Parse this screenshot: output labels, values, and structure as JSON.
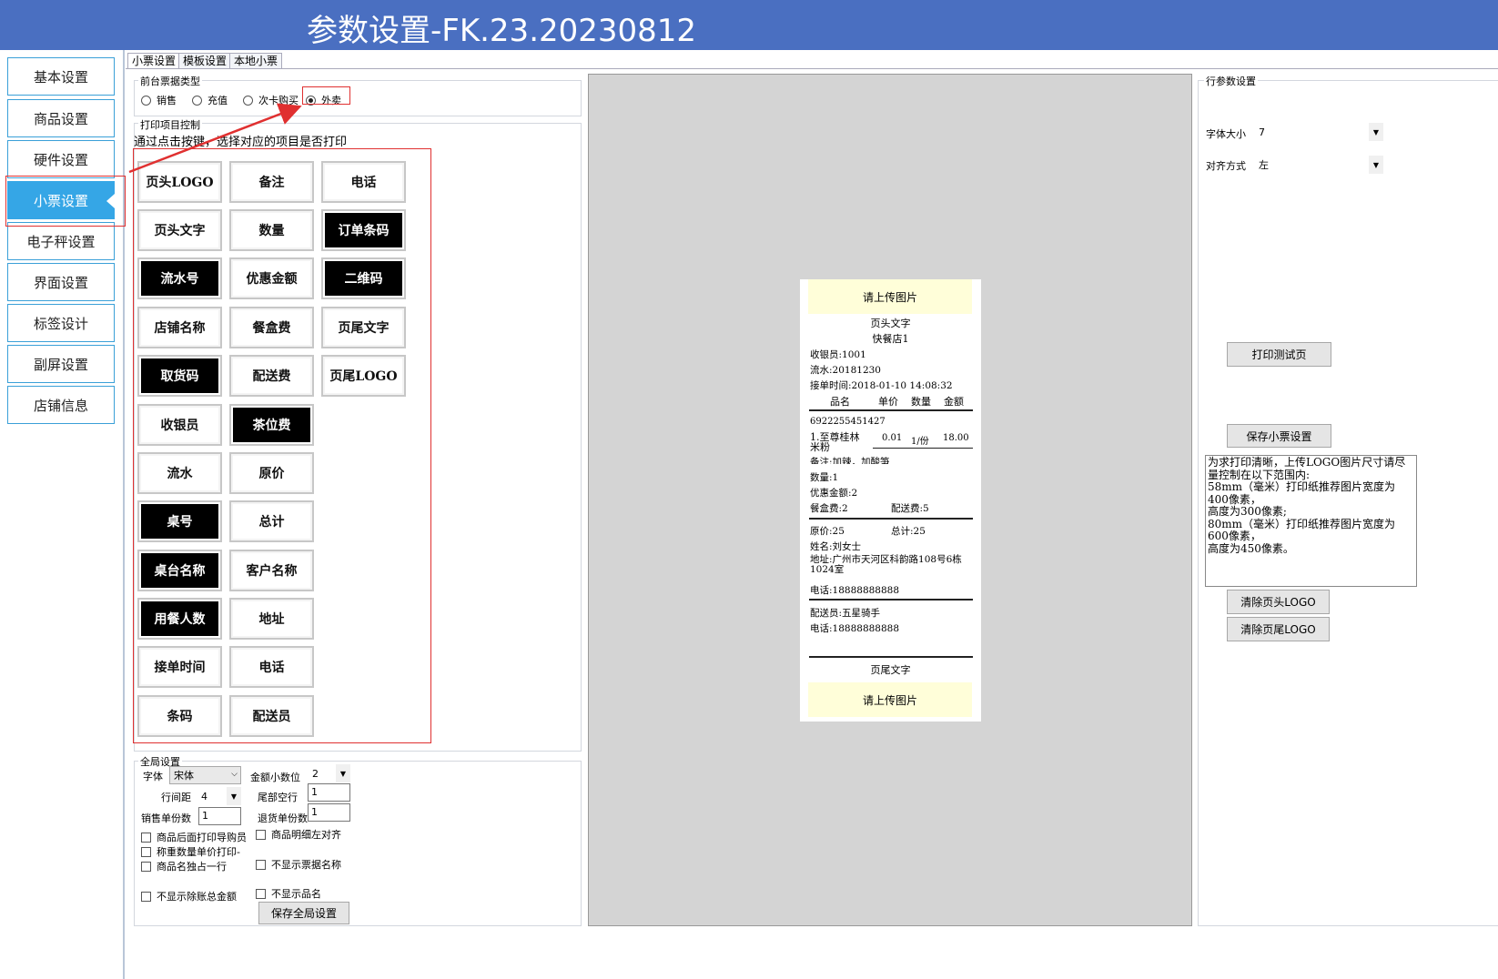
{
  "window": {
    "title": "参数设置-FK.23.20230812"
  },
  "sidebar": {
    "items": [
      {
        "label": "基本设置"
      },
      {
        "label": "商品设置"
      },
      {
        "label": "硬件设置"
      },
      {
        "label": "小票设置"
      },
      {
        "label": "电子秤设置"
      },
      {
        "label": "界面设置"
      },
      {
        "label": "标签设计"
      },
      {
        "label": "副屏设置"
      },
      {
        "label": "店铺信息"
      }
    ],
    "active_index": 3
  },
  "tabs": [
    {
      "label": "小票设置"
    },
    {
      "label": "模板设置"
    },
    {
      "label": "本地小票"
    }
  ],
  "ticket_type": {
    "group_label": "前台票据类型",
    "options": [
      {
        "label": "销售"
      },
      {
        "label": "充值"
      },
      {
        "label": "次卡购买"
      },
      {
        "label": "外卖"
      }
    ],
    "selected_index": 3
  },
  "print_items": {
    "group_label": "打印项目控制",
    "instruction": "通过点击按键，选择对应的项目是否打印",
    "buttons": [
      {
        "label": "页头LOGO",
        "on": false
      },
      {
        "label": "备注",
        "on": false
      },
      {
        "label": "电话",
        "on": false
      },
      {
        "label": "页头文字",
        "on": false
      },
      {
        "label": "数量",
        "on": false
      },
      {
        "label": "订单条码",
        "on": true
      },
      {
        "label": "流水号",
        "on": true
      },
      {
        "label": "优惠金额",
        "on": false
      },
      {
        "label": "二维码",
        "on": true
      },
      {
        "label": "店铺名称",
        "on": false
      },
      {
        "label": "餐盒费",
        "on": false
      },
      {
        "label": "页尾文字",
        "on": false
      },
      {
        "label": "取货码",
        "on": true
      },
      {
        "label": "配送费",
        "on": false
      },
      {
        "label": "页尾LOGO",
        "on": false
      },
      {
        "label": "收银员",
        "on": false
      },
      {
        "label": "茶位费",
        "on": true
      },
      {
        "label": "流水",
        "on": false
      },
      {
        "label": "原价",
        "on": false
      },
      {
        "label": "桌号",
        "on": true
      },
      {
        "label": "总计",
        "on": false
      },
      {
        "label": "桌台名称",
        "on": true
      },
      {
        "label": "客户名称",
        "on": false
      },
      {
        "label": "用餐人数",
        "on": true
      },
      {
        "label": "地址",
        "on": false
      },
      {
        "label": "接单时间",
        "on": false
      },
      {
        "label": "电话",
        "on": false
      },
      {
        "label": "条码",
        "on": false
      },
      {
        "label": "配送员",
        "on": false
      }
    ]
  },
  "global_settings": {
    "group_label": "全局设置",
    "font_label": "字体",
    "font_value": "宋体",
    "decimal_label": "金额小数位",
    "decimal_value": "2",
    "line_spacing_label": "行间距",
    "line_spacing_value": "4",
    "tail_blank_label": "尾部空行",
    "tail_blank_value": "1",
    "sale_copies_label": "销售单份数",
    "sale_copies_value": "1",
    "return_copies_label": "退货单份数",
    "return_copies_value": "1",
    "checkboxes": [
      {
        "label": "商品后面打印导购员"
      },
      {
        "label": "商品明细左对齐"
      },
      {
        "label": "称重数量单价打印-"
      },
      {
        "label": "商品名独占一行"
      },
      {
        "label": "不显示票据名称"
      },
      {
        "label": "不显示除账总金额"
      },
      {
        "label": "不显示品名"
      }
    ],
    "save_label": "保存全局设置"
  },
  "receipt_preview": {
    "logo_placeholder": "请上传图片",
    "header_text": "页头文字",
    "shop_name": "快餐店1",
    "cashier": "收银员:1001",
    "serial": "流水:20181230",
    "order_time": "接单时间:2018-01-10 14:08:32",
    "columns": [
      "品名",
      "单价",
      "数量",
      "金额"
    ],
    "barcode": "6922255451427",
    "item_name": "1.至尊桂林米粉",
    "item_price": "0.01",
    "item_qty": "1/份",
    "item_amount": "18.00",
    "item_note": "备注:加辣，加酸笋",
    "qty_total": "数量:1",
    "discount": "优惠金额:2",
    "box_fee": "餐盒费:2",
    "delivery_fee": "配送费:5",
    "original_price": "原价:25",
    "total": "总计:25",
    "customer_name": "姓名:刘女士",
    "address": "地址:广州市天河区科韵路108号6栋1024室",
    "phone": "电话:18888888888",
    "courier": "配送员:五星骑手",
    "courier_phone": "电话:18888888888",
    "footer_text": "页尾文字",
    "footer_logo_placeholder": "请上传图片"
  },
  "row_settings": {
    "group_label": "行参数设置",
    "font_size_label": "字体大小",
    "font_size_value": "7",
    "align_label": "对齐方式",
    "align_value": "左",
    "print_test_label": "打印测试页",
    "save_ticket_label": "保存小票设置",
    "tips": "为求打印清晰，上传LOGO图片尺寸请尽量控制在以下范围内:\n58mm（毫米）打印纸推荐图片宽度为400像素，\n高度为300像素;\n80mm（毫米）打印纸推荐图片宽度为600像素，\n高度为450像素。",
    "clear_header_logo_label": "清除页头LOGO",
    "clear_footer_logo_label": "清除页尾LOGO"
  }
}
